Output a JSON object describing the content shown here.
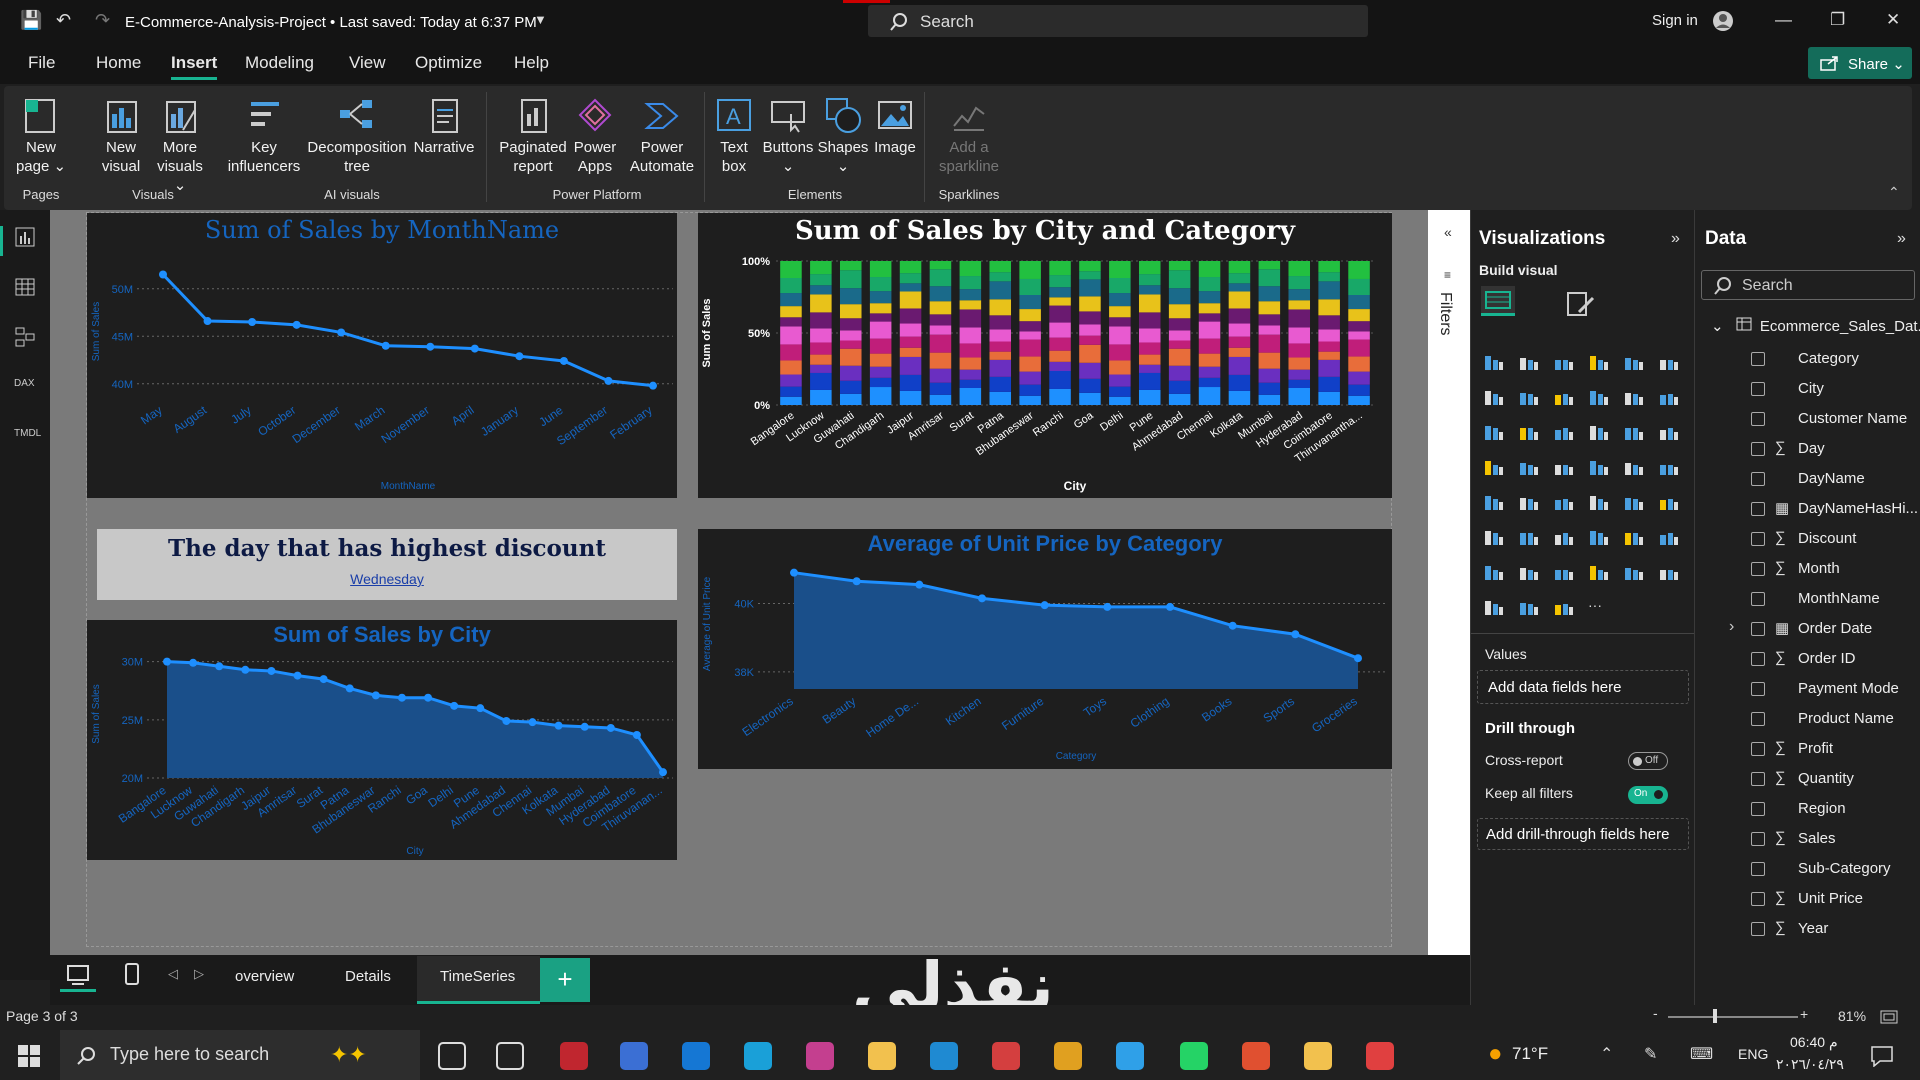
{
  "titlebar": {
    "doc_title": "E-Commerce-Analysis-Project • Last saved: Today at 6:37 PM",
    "search": "Search",
    "signin": "Sign in"
  },
  "menu": {
    "file": "File",
    "home": "Home",
    "insert": "Insert",
    "modeling": "Modeling",
    "view": "View",
    "optimize": "Optimize",
    "help": "Help",
    "share": "Share"
  },
  "ribbon": {
    "buttons": [
      {
        "l1": "New",
        "l2": "page ⌄"
      },
      {
        "l1": "New",
        "l2": "visual"
      },
      {
        "l1": "More",
        "l2": "visuals ⌄"
      },
      {
        "l1": "Key",
        "l2": "influencers"
      },
      {
        "l1": "Decomposition",
        "l2": "tree"
      },
      {
        "l1": "Narrative",
        "l2": ""
      },
      {
        "l1": "Paginated",
        "l2": "report"
      },
      {
        "l1": "Power",
        "l2": "Apps"
      },
      {
        "l1": "Power",
        "l2": "Automate"
      },
      {
        "l1": "Text",
        "l2": "box"
      },
      {
        "l1": "Buttons",
        "l2": "⌄"
      },
      {
        "l1": "Shapes",
        "l2": "⌄"
      },
      {
        "l1": "Image",
        "l2": ""
      },
      {
        "l1": "Add a",
        "l2": "sparkline"
      }
    ],
    "groups": [
      "Pages",
      "Visuals",
      "AI visuals",
      "Power Platform",
      "Elements",
      "Sparklines"
    ]
  },
  "chart_data": [
    {
      "type": "line",
      "title": "Sum of Sales by MonthName",
      "xlabel": "MonthName",
      "ylabel": "Sum of Sales",
      "categories": [
        "May",
        "August",
        "July",
        "October",
        "December",
        "March",
        "November",
        "April",
        "January",
        "June",
        "September",
        "February"
      ],
      "values": [
        51.5,
        46.6,
        46.5,
        46.2,
        45.4,
        44.0,
        43.9,
        43.7,
        42.9,
        42.4,
        40.3,
        39.8
      ],
      "ylim": [
        38.5,
        52.5
      ],
      "yticks": [
        "40M",
        "45M",
        "50M"
      ],
      "ytick_values": [
        40,
        45,
        50
      ]
    },
    {
      "type": "bar",
      "stacked_percent": true,
      "title": "Sum of Sales by City and Category",
      "xlabel": "City",
      "ylabel": "Sum of Sales",
      "yticks": [
        "0%",
        "50%",
        "100%"
      ],
      "categories": [
        "Bangalore",
        "Lucknow",
        "Guwahati",
        "Chandigarh",
        "Jaipur",
        "Amritsar",
        "Surat",
        "Patna",
        "Bhubaneswar",
        "Ranchi",
        "Goa",
        "Delhi",
        "Pune",
        "Ahmedabad",
        "Chennai",
        "Kolkata",
        "Mumbai",
        "Hyderabad",
        "Coimbatore",
        "Thiruvanantha..."
      ],
      "colors": [
        "#1e90ff",
        "#1040c8",
        "#6a2fc0",
        "#e86d3a",
        "#c01e7a",
        "#e85ad0",
        "#6a1a70",
        "#e8c21a",
        "#1a6a8a",
        "#18a868",
        "#22c040"
      ]
    },
    {
      "type": "area",
      "title": "Sum of Sales by City",
      "xlabel": "City",
      "ylabel": "Sum of Sales",
      "categories": [
        "Bangalore",
        "Lucknow",
        "Guwahati",
        "Chandigarh",
        "Jaipur",
        "Amritsar",
        "Surat",
        "Patna",
        "Bhubaneswar",
        "Ranchi",
        "Goa",
        "Delhi",
        "Pune",
        "Ahmedabad",
        "Chennai",
        "Kolkata",
        "Mumbai",
        "Hyderabad",
        "Coimbatore",
        "Thiruvanan..."
      ],
      "values": [
        30.0,
        29.9,
        29.6,
        29.3,
        29.2,
        28.8,
        28.5,
        27.7,
        27.1,
        26.9,
        26.9,
        26.2,
        26.0,
        24.9,
        24.8,
        24.5,
        24.4,
        24.3,
        23.7,
        20.5
      ],
      "ylim": [
        20,
        31
      ],
      "yticks": [
        "20M",
        "25M",
        "30M"
      ],
      "ytick_values": [
        20,
        25,
        30
      ]
    },
    {
      "type": "area",
      "title": "Average of Unit Price by Category",
      "xlabel": "Category",
      "ylabel": "Average of Unit Price",
      "categories": [
        "Electronics",
        "Beauty",
        "Home De...",
        "Kitchen",
        "Furniture",
        "Toys",
        "Clothing",
        "Books",
        "Sports",
        "Groceries"
      ],
      "values": [
        40.9,
        40.65,
        40.55,
        40.15,
        39.95,
        39.9,
        39.9,
        39.35,
        39.1,
        38.4
      ],
      "ylim": [
        37.5,
        41.3
      ],
      "yticks": [
        "38K",
        "40K"
      ],
      "ytick_values": [
        38,
        40
      ]
    }
  ],
  "card": {
    "title": "The day that has highest discount",
    "value": "Wednesday"
  },
  "filters": {
    "label": "Filters"
  },
  "viz": {
    "title": "Visualizations",
    "build": "Build visual",
    "values": "Values",
    "add_fields": "Add data fields here",
    "drill": "Drill through",
    "cross": "Cross-report",
    "cross_state": "Off",
    "keep": "Keep all filters",
    "keep_state": "On",
    "add_drill": "Add drill-through fields here"
  },
  "data": {
    "title": "Data",
    "search": "Search",
    "table": "Ecommerce_Sales_Dat...",
    "fields": [
      {
        "name": "Category",
        "sigma": ""
      },
      {
        "name": "City",
        "sigma": ""
      },
      {
        "name": "Customer Name",
        "sigma": ""
      },
      {
        "name": "Day",
        "sigma": "∑"
      },
      {
        "name": "DayName",
        "sigma": ""
      },
      {
        "name": "DayNameHasHi...",
        "sigma": "▦"
      },
      {
        "name": "Discount",
        "sigma": "∑"
      },
      {
        "name": "Month",
        "sigma": "∑"
      },
      {
        "name": "MonthName",
        "sigma": ""
      },
      {
        "name": "Order Date",
        "sigma": "▦"
      },
      {
        "name": "Order ID",
        "sigma": "∑"
      },
      {
        "name": "Payment Mode",
        "sigma": ""
      },
      {
        "name": "Product Name",
        "sigma": ""
      },
      {
        "name": "Profit",
        "sigma": "∑"
      },
      {
        "name": "Quantity",
        "sigma": "∑"
      },
      {
        "name": "Region",
        "sigma": ""
      },
      {
        "name": "Sales",
        "sigma": "∑"
      },
      {
        "name": "Sub-Category",
        "sigma": ""
      },
      {
        "name": "Unit Price",
        "sigma": "∑"
      },
      {
        "name": "Year",
        "sigma": "∑"
      }
    ]
  },
  "tabs": {
    "t1": "overview",
    "t2": "Details",
    "t3": "TimeSeries",
    "add": "+"
  },
  "status": {
    "page": "Page 3 of 3",
    "zoom": "81%"
  },
  "watermark": "نفذلي",
  "taskbar": {
    "search": "Type here to search",
    "temp": "71°F",
    "lang": "ENG",
    "time": "06:40 م",
    "date": "٢٠٢٦/٠٤/٢٩"
  }
}
